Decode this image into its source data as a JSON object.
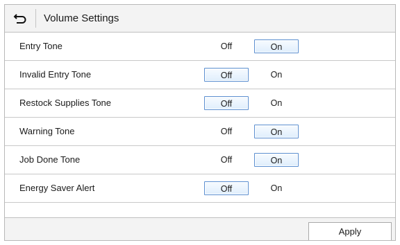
{
  "header": {
    "title": "Volume Settings",
    "back_icon": "back-arrow-icon"
  },
  "settings": [
    {
      "label": "Entry Tone",
      "off_label": "Off",
      "on_label": "On",
      "value": "On"
    },
    {
      "label": "Invalid Entry Tone",
      "off_label": "Off",
      "on_label": "On",
      "value": "Off"
    },
    {
      "label": "Restock Supplies Tone",
      "off_label": "Off",
      "on_label": "On",
      "value": "Off"
    },
    {
      "label": "Warning Tone",
      "off_label": "Off",
      "on_label": "On",
      "value": "On"
    },
    {
      "label": "Job Done Tone",
      "off_label": "Off",
      "on_label": "On",
      "value": "On"
    },
    {
      "label": "Energy Saver Alert",
      "off_label": "Off",
      "on_label": "On",
      "value": "Off"
    }
  ],
  "footer": {
    "apply_label": "Apply"
  },
  "colors": {
    "selected_border": "#5a8ed0",
    "bar_background": "#f3f3f3"
  }
}
